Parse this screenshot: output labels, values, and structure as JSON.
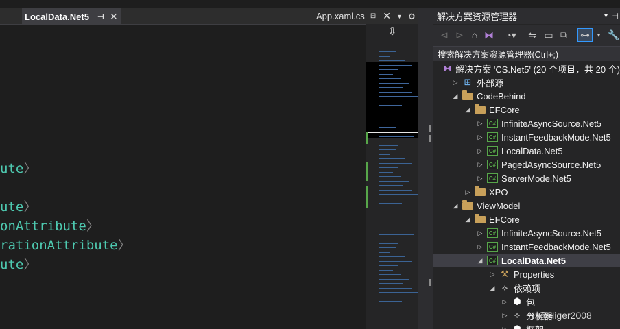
{
  "editor": {
    "active_tab": {
      "label": "LocalData.Net5",
      "pin": "⊣",
      "close": "✕"
    },
    "second_tab": {
      "label": "App.xaml.cs",
      "pin": "⊟",
      "close": "✕",
      "dropdown": "▼",
      "gear": "⚙"
    },
    "code_lines": [
      {
        "text": "ute",
        "close": "〉"
      },
      {
        "text": "ute",
        "close": "〉"
      },
      {
        "text": "onAttribute",
        "close": "〉"
      },
      {
        "text": "rationAttribute",
        "close": "〉"
      },
      {
        "text": "ute",
        "close": "〉"
      }
    ]
  },
  "minimap": {
    "split_icon": "⇳"
  },
  "solution_explorer": {
    "title": "解决方案资源管理器",
    "title_dropdown": "▾",
    "title_pin": "⊣",
    "toolbar_icons": [
      "back-icon",
      "forward-icon",
      "home-icon",
      "vs-icon",
      "history-icon",
      "sync-icon",
      "collapse-icon",
      "copy-icon",
      "filter-icon",
      "wrench-icon"
    ],
    "search_placeholder": "搜索解决方案资源管理器(Ctrl+;)",
    "tree": [
      {
        "label": "解决方案 'CS.Net5' (20 个项目，共 20 个)",
        "icon": "sln",
        "level": 0,
        "chev": ""
      },
      {
        "label": "外部源",
        "icon": "ext",
        "level": 1,
        "chev": "▷"
      },
      {
        "label": "CodeBehind",
        "icon": "folder",
        "level": 1,
        "chev": "◢"
      },
      {
        "label": "EFCore",
        "icon": "folder",
        "level": 2,
        "chev": "◢"
      },
      {
        "label": "InfiniteAsyncSource.Net5",
        "icon": "cs",
        "level": 3,
        "chev": "▷"
      },
      {
        "label": "InstantFeedbackMode.Net5",
        "icon": "cs",
        "level": 3,
        "chev": "▷"
      },
      {
        "label": "LocalData.Net5",
        "icon": "cs",
        "level": 3,
        "chev": "▷"
      },
      {
        "label": "PagedAsyncSource.Net5",
        "icon": "cs",
        "level": 3,
        "chev": "▷"
      },
      {
        "label": "ServerMode.Net5",
        "icon": "cs",
        "level": 3,
        "chev": "▷"
      },
      {
        "label": "XPO",
        "icon": "folder",
        "level": 2,
        "chev": "▷"
      },
      {
        "label": "ViewModel",
        "icon": "folder",
        "level": 1,
        "chev": "◢"
      },
      {
        "label": "EFCore",
        "icon": "folder",
        "level": 2,
        "chev": "◢"
      },
      {
        "label": "InfiniteAsyncSource.Net5",
        "icon": "cs",
        "level": 3,
        "chev": "▷"
      },
      {
        "label": "InstantFeedbackMode.Net5",
        "icon": "cs",
        "level": 3,
        "chev": "▷"
      },
      {
        "label": "LocalData.Net5",
        "icon": "cs",
        "level": 3,
        "chev": "◢",
        "selected": true
      },
      {
        "label": "Properties",
        "icon": "props",
        "level": 4,
        "chev": "▷"
      },
      {
        "label": "依赖项",
        "icon": "dep",
        "level": 4,
        "chev": "◢"
      },
      {
        "label": "包",
        "icon": "pkg",
        "level": 5,
        "chev": "▷"
      },
      {
        "label": "分析器",
        "icon": "dep",
        "level": 5,
        "chev": "▷"
      },
      {
        "label": "框架",
        "icon": "pkg",
        "level": 5,
        "chev": "▷"
      }
    ]
  },
  "watermark": "N @Higer2008"
}
